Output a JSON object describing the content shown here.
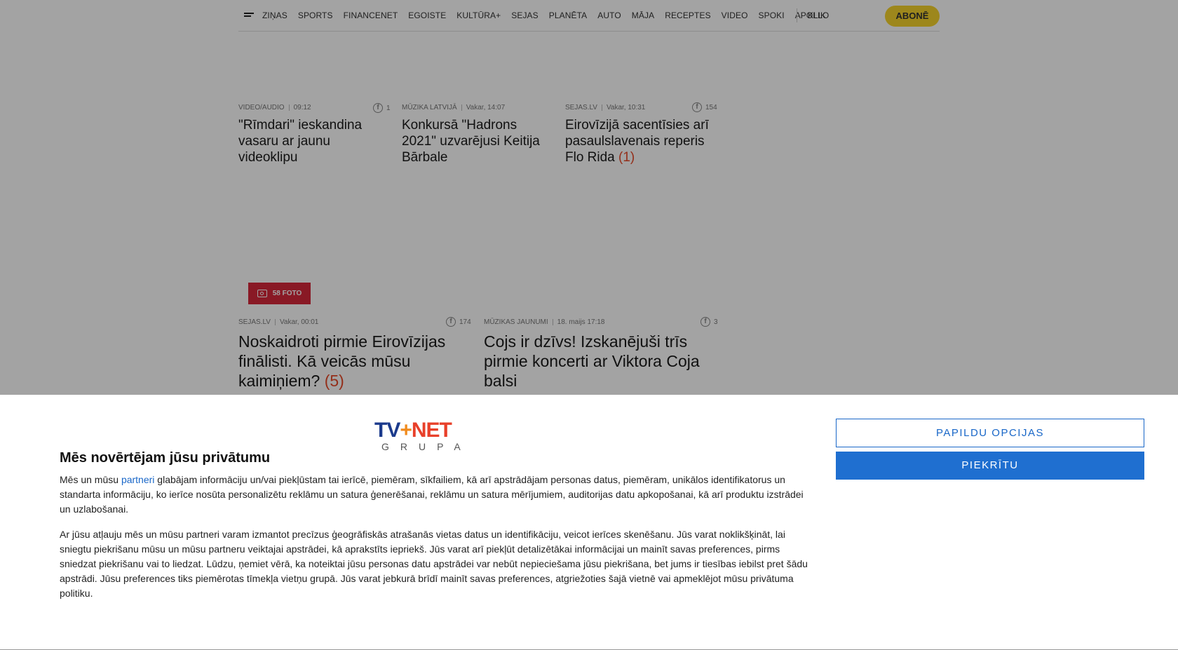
{
  "nav": {
    "links": [
      "ZIŅAS",
      "SPORTS",
      "FINANCENET",
      "EGOISTE",
      "KULTŪRA+",
      "SEJAS",
      "PLANĒTA",
      "AUTO",
      "MĀJA",
      "RECEPTES",
      "VIDEO",
      "SPOKI",
      "APOLLO"
    ],
    "klik": "KLIK",
    "subscribe": "ABONĒ"
  },
  "articles": [
    {
      "category": "VIDEO/AUDIO",
      "time": "09:12",
      "comments": "1",
      "title": "\"Rīmdari\" ieskandina vasaru ar jaunu videoklipu",
      "count": ""
    },
    {
      "category": "MŪZIKA LATVIJĀ",
      "time": "Vakar, 14:07",
      "comments": "",
      "title": "Konkursā \"Hadrons 2021\" uzvarējusi Keitija Bārbale",
      "count": ""
    },
    {
      "category": "SEJAS.LV",
      "time": "Vakar, 10:31",
      "comments": "154",
      "title": "Eirovīzijā sacentīsies arī pasaulslavenais reperis Flo Rida",
      "count": "(1)"
    },
    {
      "category": "SEJAS.LV",
      "time": "Vakar, 00:01",
      "comments": "174",
      "title": "Noskaidroti pirmie Eirovīzijas fināl­isti. Kā veicās mūsu kaimiņiem?",
      "count": "(5)",
      "photo": "58 FOTO"
    },
    {
      "category": "MŪZIKAS JAUNUMI",
      "time": "18. maijs 17:18",
      "comments": "3",
      "title": "Cojs ir dzīvs! Izskanējuši trīs pirmie koncerti ar Viktora Coja balsi",
      "count": ""
    }
  ],
  "consent": {
    "logo_main_tv": "TV",
    "logo_main_plus": "+",
    "logo_main_net": "NET",
    "logo_sub": "GRUPA",
    "title": "Mēs novērtējam jūsu privātumu",
    "p1_before": "Mēs un mūsu ",
    "p1_link": "partneri",
    "p1_after": " glabājam informāciju un/vai piekļūstam tai ierīcē, piemēram, sīkfailiem, kā arī apstrādājam personas datus, piemēram, unikālos identifikatorus un standarta informāciju, ko ierīce nosūta personalizētu reklāmu un satura ģenerēšanai, reklāmu un satura mērījumiem, auditorijas datu apkopošanai, kā arī produktu izstrādei un uzlabošanai.",
    "p2": "Ar jūsu atļauju mēs un mūsu partneri varam izmantot precīzus ģeogrāfiskās atrašanās vietas datus un identifikāciju, veicot ierīces skenēšanu. Jūs varat noklikšķināt, lai sniegtu piekrišanu mūsu un mūsu partneru veiktajai apstrādei, kā aprakstīts iepriekš. Jūs varat arī piekļūt detalizētākai informācijai un mainīt savas preferences, pirms sniedzat piekrišanu vai to liedzat. Lūdzu, ņemiet vērā, ka noteiktai jūsu personas datu apstrādei var nebūt nepieciešama jūsu piekrišana, bet jums ir tiesības iebilst pret šādu apstrādi. Jūsu preferences tiks piemērotas tīmekļa vietņu grupā. Jūs varat jebkurā brīdī mainīt savas preferences, atgriežoties šajā vietnē vai apmeklējot mūsu privātuma politiku.",
    "more_options": "PAPILDU OPCIJAS",
    "agree": "PIEKRĪTU"
  }
}
